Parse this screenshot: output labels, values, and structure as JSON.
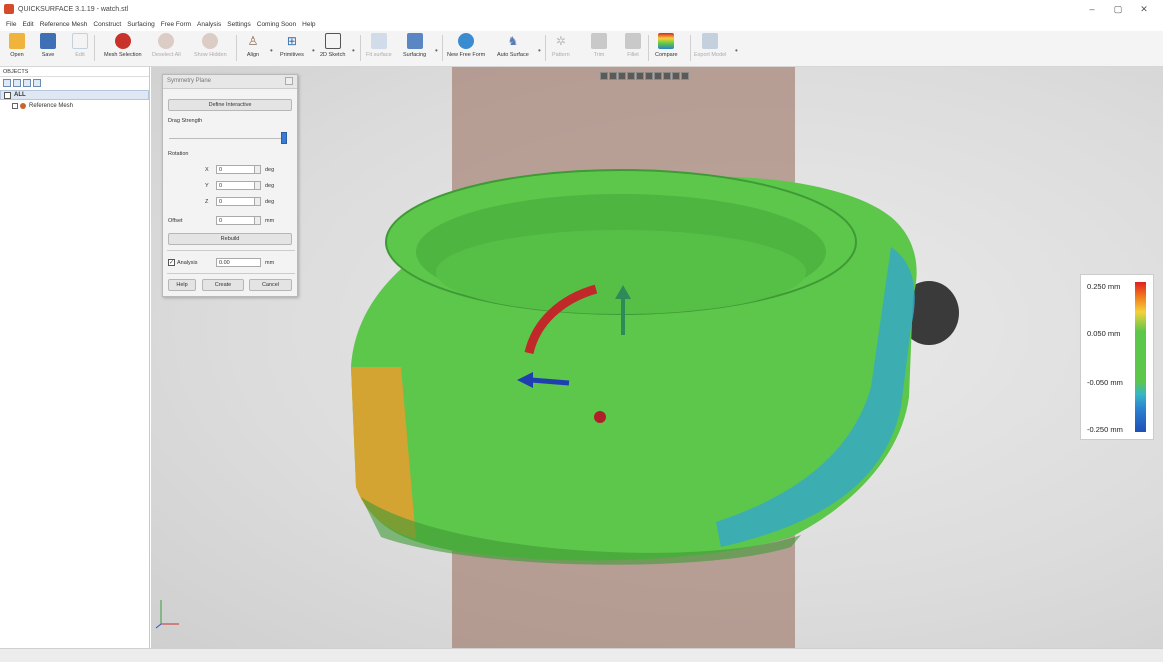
{
  "window": {
    "title": "QUICKSURFACE 3.1.19 - watch.stl",
    "controls": [
      "–",
      "▢",
      "✕"
    ]
  },
  "menu": [
    "File",
    "Edit",
    "Reference Mesh",
    "Construct",
    "Surfacing",
    "Free Form",
    "Analysis",
    "Settings",
    "Coming Soon",
    "Help"
  ],
  "toolbar": {
    "open": "Open",
    "save": "Save",
    "edit": "Edit",
    "mesh_selection": "Mesh Selection",
    "deselect_all": "Deselect All",
    "show_hidden": "Show Hidden",
    "align": "Align",
    "primitives": "Primitives",
    "sketch_2d": "2D Sketch",
    "fit_surface": "Fit surface",
    "surfacing": "Surfacing",
    "new_free_form": "New Free Form",
    "auto_surface": "Auto Surface",
    "pattern": "Pattern",
    "trim": "Trim",
    "fillet": "Fillet",
    "compare": "Compare",
    "export_model": "Export Model"
  },
  "objects_panel": {
    "header": "OBJECTS",
    "root": "ALL",
    "items": [
      "Reference Mesh"
    ]
  },
  "dialog": {
    "title": "Symmetry Plane",
    "define_interactive": "Define Interactive",
    "drag_strength": "Drag Strength",
    "rotation": "Rotation",
    "rx_label": "X",
    "ry_label": "Y",
    "rz_label": "Z",
    "rx": "0",
    "ry": "0",
    "rz": "0",
    "deg": "deg",
    "offset_label": "Offset",
    "offset": "0",
    "mm": "mm",
    "rebuild": "Rebuild",
    "analysis_label": "Analysis",
    "analysis_value": "0.00",
    "help": "Help",
    "create": "Create",
    "cancel": "Cancel"
  },
  "legend": {
    "labels": [
      "0.250 mm",
      "0.050 mm",
      "-0.050 mm",
      "-0.250 mm"
    ],
    "colors": [
      "#e02020",
      "#f4d13a",
      "#5cc74a",
      "#36b6c8",
      "#1f4fb6"
    ]
  },
  "colors": {
    "mesh_green": "#5cc74a",
    "plane": "#96695a",
    "accent_blue": "#3a7bd5"
  }
}
